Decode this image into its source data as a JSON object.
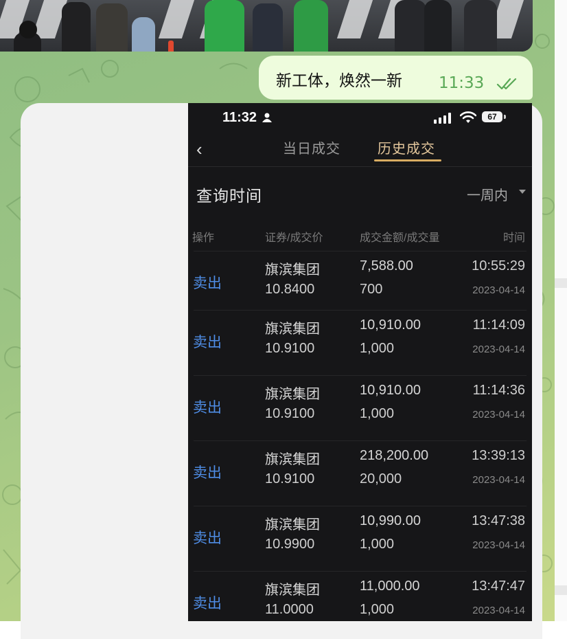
{
  "outgoing_message": {
    "text": "新工体，焕然一新",
    "time": "11:33",
    "status_icon": "double-check-icon"
  },
  "phone_screenshot": {
    "status_bar": {
      "time": "11:32",
      "battery": "67"
    },
    "tabs": [
      {
        "label": "当日成交",
        "active": false
      },
      {
        "label": "历史成交",
        "active": true
      }
    ],
    "query": {
      "label": "查询时间",
      "range": "一周内"
    },
    "table": {
      "headers": [
        "操作",
        "证券/成交价",
        "成交金额/成交量",
        "时间"
      ],
      "rows": [
        {
          "action": "卖出",
          "name": "旗滨集团",
          "price": "10.8400",
          "amount": "7,588.00",
          "qty": "700",
          "time": "10:55:29",
          "date": "2023-04-14"
        },
        {
          "action": "卖出",
          "name": "旗滨集团",
          "price": "10.9100",
          "amount": "10,910.00",
          "qty": "1,000",
          "time": "11:14:09",
          "date": "2023-04-14"
        },
        {
          "action": "卖出",
          "name": "旗滨集团",
          "price": "10.9100",
          "amount": "10,910.00",
          "qty": "1,000",
          "time": "11:14:36",
          "date": "2023-04-14"
        },
        {
          "action": "卖出",
          "name": "旗滨集团",
          "price": "10.9100",
          "amount": "218,200.00",
          "qty": "20,000",
          "time": "13:39:13",
          "date": "2023-04-14"
        },
        {
          "action": "卖出",
          "name": "旗滨集团",
          "price": "10.9900",
          "amount": "10,990.00",
          "qty": "1,000",
          "time": "13:47:38",
          "date": "2023-04-14"
        },
        {
          "action": "卖出",
          "name": "旗滨集团",
          "price": "11.0000",
          "amount": "11,000.00",
          "qty": "1,000",
          "time": "13:47:47",
          "date": "2023-04-14"
        }
      ]
    }
  },
  "colors": {
    "accent_gold": "#d8ac62",
    "sell_blue": "#4f8de6",
    "outgoing_bubble": "#eefcdd",
    "time_green": "#59a856"
  }
}
